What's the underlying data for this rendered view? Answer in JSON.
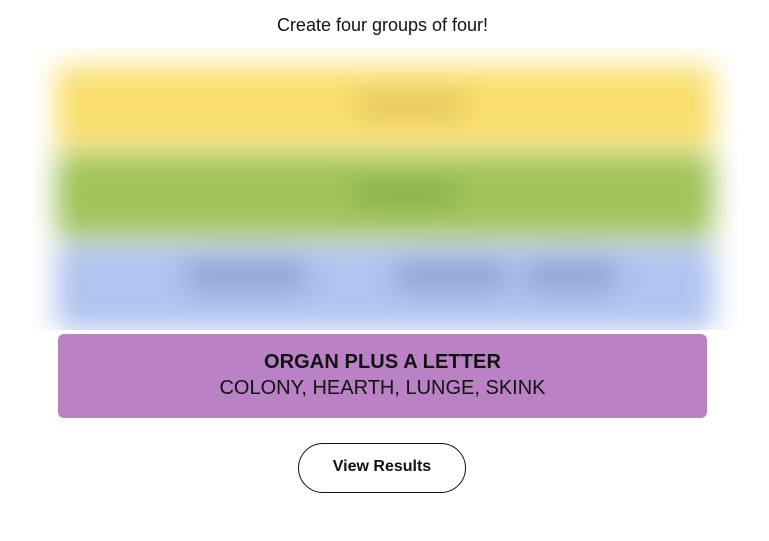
{
  "instructions": "Create four groups of four!",
  "colors": {
    "yellow": "#f9df6d",
    "green": "#a0c35a",
    "blue": "#b0c4ef",
    "purple": "#ba81c5",
    "text": "#121212"
  },
  "hidden_groups": [
    {
      "color_name": "yellow",
      "color": "#f9df6d"
    },
    {
      "color_name": "green",
      "color": "#a0c35a"
    },
    {
      "color_name": "blue",
      "color": "#b0c4ef"
    }
  ],
  "solved_group": {
    "title": "ORGAN PLUS A LETTER",
    "members": "COLONY, HEARTH, LUNGE, SKINK",
    "color": "#ba81c5"
  },
  "results_button": {
    "label": "View Results"
  }
}
